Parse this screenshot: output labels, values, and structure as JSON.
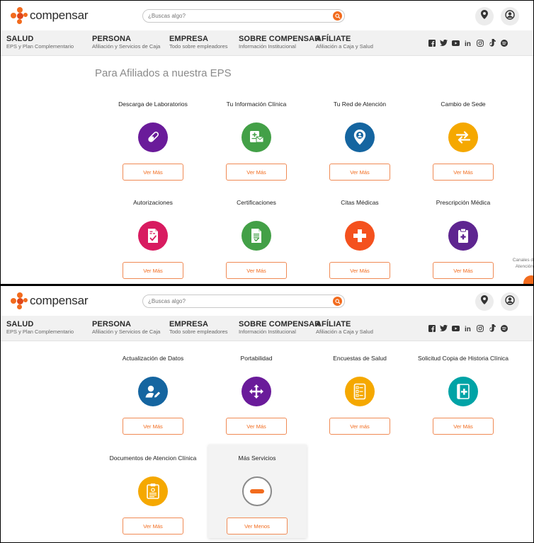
{
  "header": {
    "logo_text": "compensar",
    "search_placeholder": "¿Buscas algo?",
    "brand_color": "#f26b1d"
  },
  "nav": [
    {
      "title": "SALUD",
      "sub": "EPS y Plan Complementario"
    },
    {
      "title": "PERSONA",
      "sub": "Afiliación y Servicios de Caja"
    },
    {
      "title": "EMPRESA",
      "sub": "Todo sobre empleadores"
    },
    {
      "title": "SOBRE COMPENSAR",
      "sub": "Información Institucional"
    },
    {
      "title": "AFÍLIATE",
      "sub": "Afiliación a Caja y Salud"
    }
  ],
  "social_icons": [
    "facebook-icon",
    "twitter-icon",
    "youtube-icon",
    "linkedin-icon",
    "instagram-icon",
    "tiktok-icon",
    "spotify-icon"
  ],
  "section_title": "Para Afiliados a nuestra EPS",
  "cards_row1": [
    {
      "title": "Descarga de Laboratorios",
      "button": "Ver Más",
      "icon": "test-tube-icon",
      "color": "#6a1b9a"
    },
    {
      "title": "Tu Información Clínica",
      "button": "Ver Más",
      "icon": "clinical-info-icon",
      "color": "#43a047"
    },
    {
      "title": "Tu Red de Atención",
      "button": "Ver Más",
      "icon": "location-network-icon",
      "color": "#1565a0"
    },
    {
      "title": "Cambio de Sede",
      "button": "Ver Más",
      "icon": "swap-arrows-icon",
      "color": "#f5a800"
    }
  ],
  "cards_row2": [
    {
      "title": "Autorizaciones",
      "button": "Ver Más",
      "icon": "authorization-doc-icon",
      "color": "#d81b60"
    },
    {
      "title": "Certificaciones",
      "button": "Ver Más",
      "icon": "certificate-doc-icon",
      "color": "#43a047"
    },
    {
      "title": "Citas Médicas",
      "button": "Ver Más",
      "icon": "medical-cross-icon",
      "color": "#f4511e"
    },
    {
      "title": "Prescripción Médica",
      "button": "Ver Más",
      "icon": "prescription-clipboard-icon",
      "color": "#5e2590"
    }
  ],
  "cards_row3": [
    {
      "title": "Actualización de Datos",
      "button": "Ver Más",
      "icon": "user-edit-icon",
      "color": "#1565a0"
    },
    {
      "title": "Portabilidad",
      "button": "Ver Más",
      "icon": "move-arrows-icon",
      "color": "#6a1b9a"
    },
    {
      "title": "Encuestas de Salud",
      "button": "Ver más",
      "icon": "survey-doc-icon",
      "color": "#f5a800"
    },
    {
      "title": "Solicitud Copia de Historia Clínica",
      "button": "Ver Más",
      "icon": "medical-record-icon",
      "color": "#00a3a6"
    }
  ],
  "cards_row4": [
    {
      "title": "Documentos de Atencion Clínica",
      "button": "Ver Más",
      "icon": "clinical-clipboard-icon",
      "color": "#f5a800"
    },
    {
      "title": "Más Servicios",
      "button": "Ver Menos",
      "icon": "minus-circle-icon",
      "color": "#f26b1d"
    }
  ],
  "side": {
    "canales_line1": "Canales d",
    "canales_line2": "Atención"
  }
}
